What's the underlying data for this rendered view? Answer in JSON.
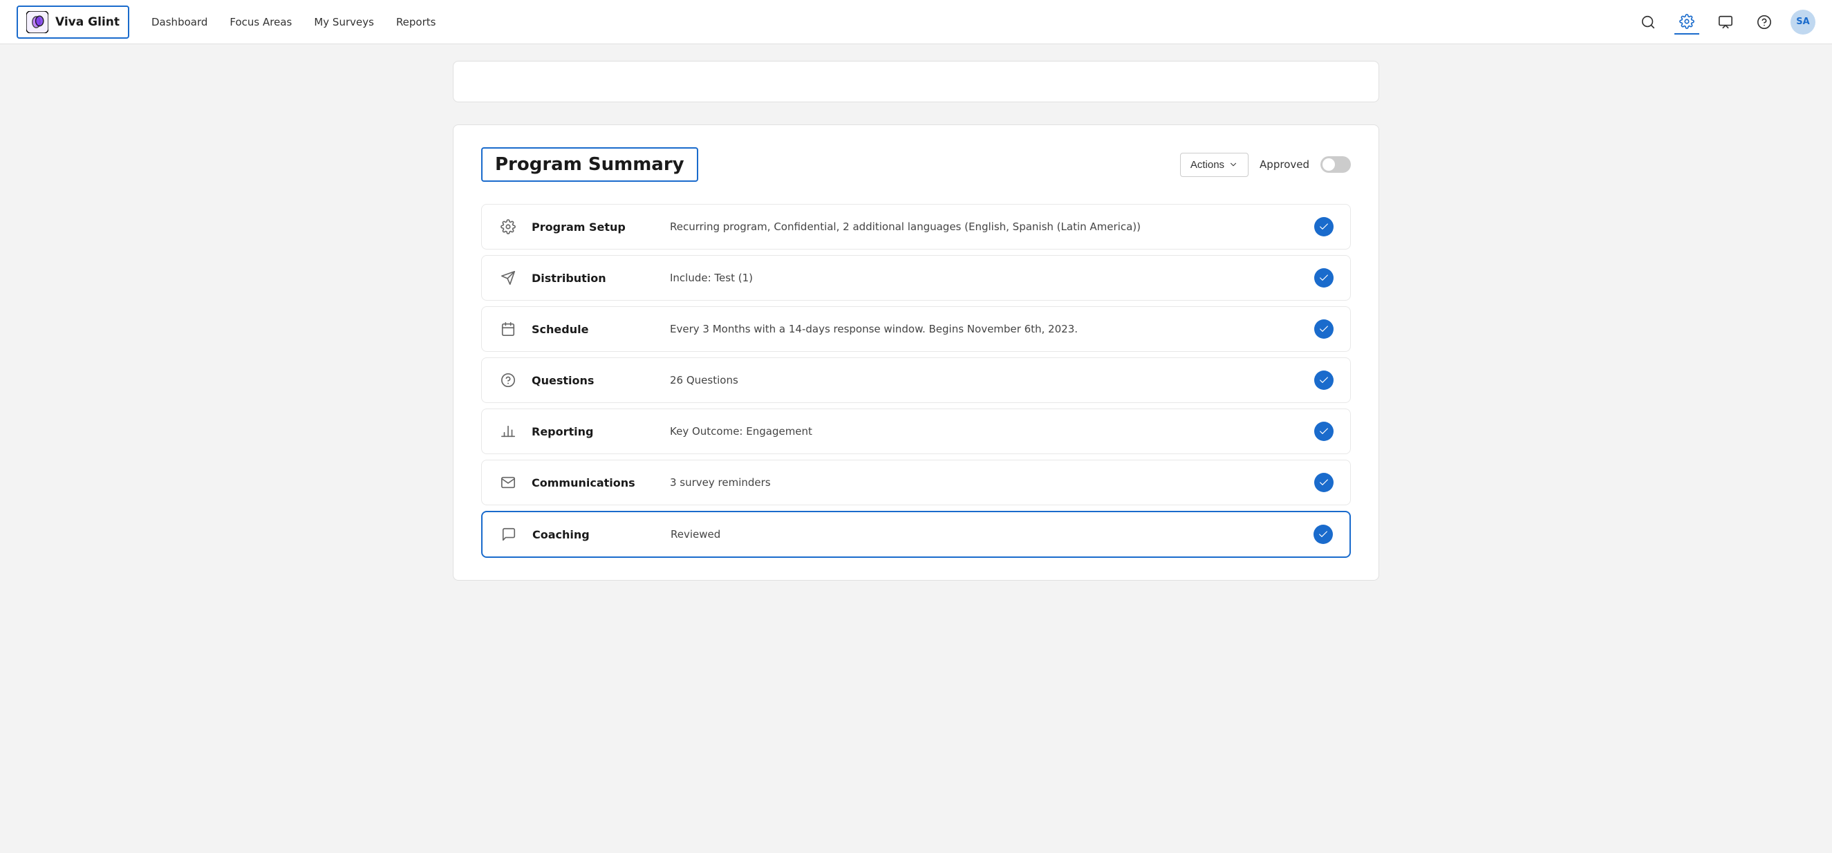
{
  "app": {
    "logo_text": "Viva Glint"
  },
  "nav": {
    "links": [
      "Dashboard",
      "Focus Areas",
      "My Surveys",
      "Reports"
    ],
    "avatar_initials": "SA"
  },
  "program_summary": {
    "title": "Program Summary",
    "actions_label": "Actions",
    "approved_label": "Approved",
    "rows": [
      {
        "id": "program-setup",
        "label": "Program Setup",
        "desc": "Recurring program, Confidential, 2 additional languages (English, Spanish (Latin America))",
        "icon": "settings",
        "checked": true,
        "highlighted": false
      },
      {
        "id": "distribution",
        "label": "Distribution",
        "desc": "Include: Test (1)",
        "icon": "send",
        "checked": true,
        "highlighted": false
      },
      {
        "id": "schedule",
        "label": "Schedule",
        "desc": "Every 3 Months with a 14-days response window. Begins November 6th, 2023.",
        "icon": "calendar",
        "checked": true,
        "highlighted": false
      },
      {
        "id": "questions",
        "label": "Questions",
        "desc": "26 Questions",
        "icon": "help-circle",
        "checked": true,
        "highlighted": false
      },
      {
        "id": "reporting",
        "label": "Reporting",
        "desc": "Key Outcome: Engagement",
        "icon": "bar-chart",
        "checked": true,
        "highlighted": false
      },
      {
        "id": "communications",
        "label": "Communications",
        "desc": "3 survey reminders",
        "icon": "mail",
        "checked": true,
        "highlighted": false
      },
      {
        "id": "coaching",
        "label": "Coaching",
        "desc": "Reviewed",
        "icon": "message-circle",
        "checked": true,
        "highlighted": true
      }
    ]
  }
}
